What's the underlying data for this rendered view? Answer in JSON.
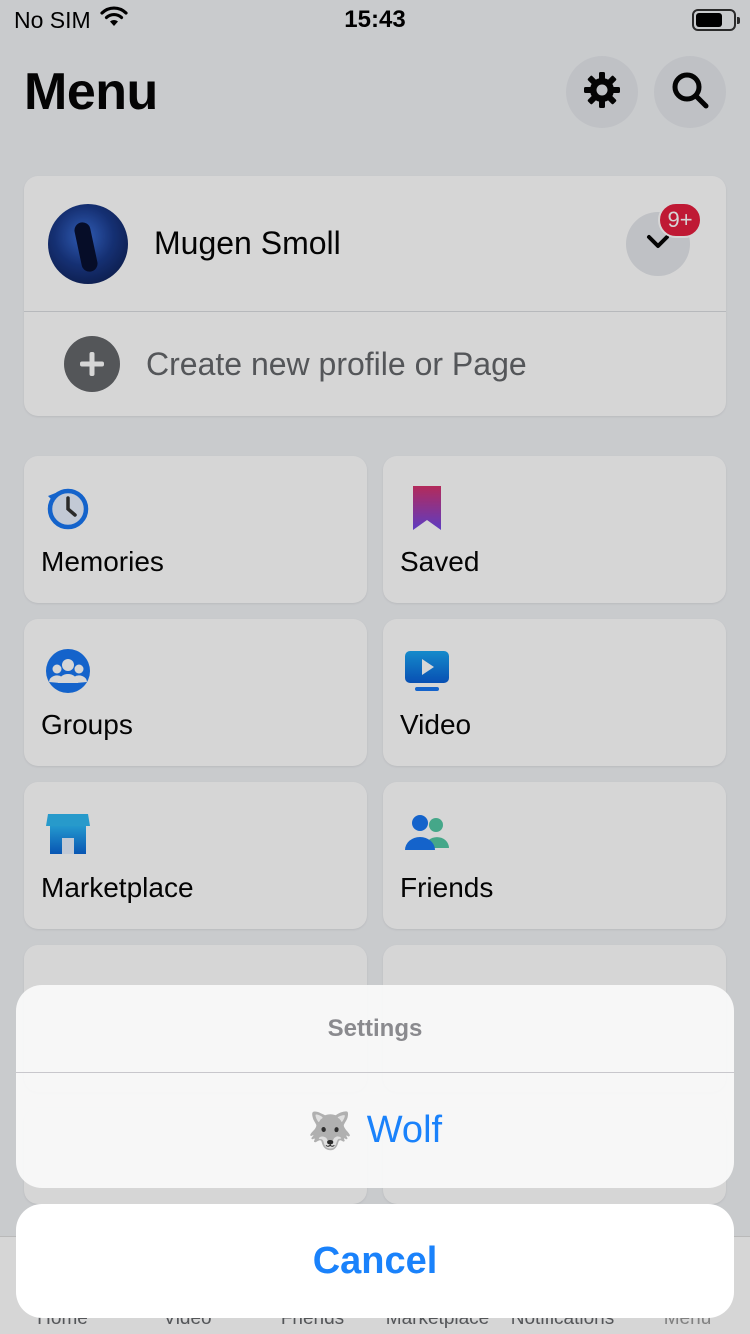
{
  "status_bar": {
    "carrier": "No SIM",
    "time": "15:43"
  },
  "header": {
    "title": "Menu",
    "settings_icon": "gear-icon",
    "search_icon": "search-icon"
  },
  "profile": {
    "name": "Mugen  Smoll",
    "notification_badge": "9+",
    "create_label": "Create new profile or Page"
  },
  "shortcuts": [
    {
      "label": "Memories",
      "icon": "memories-icon"
    },
    {
      "label": "Saved",
      "icon": "saved-icon"
    },
    {
      "label": "Groups",
      "icon": "groups-icon"
    },
    {
      "label": "Video",
      "icon": "video-icon"
    },
    {
      "label": "Marketplace",
      "icon": "marketplace-icon"
    },
    {
      "label": "Friends",
      "icon": "friends-icon"
    }
  ],
  "tab_bar": {
    "items": [
      {
        "label": "Home"
      },
      {
        "label": "Video"
      },
      {
        "label": "Friends"
      },
      {
        "label": "Marketplace"
      },
      {
        "label": "Notifications"
      },
      {
        "label": "Menu"
      }
    ]
  },
  "action_sheet": {
    "title": "Settings",
    "option": {
      "emoji": "🐺",
      "label": "Wolf"
    },
    "cancel_label": "Cancel"
  },
  "colors": {
    "accent": "#1a82fb",
    "badge": "#e41e3f"
  }
}
